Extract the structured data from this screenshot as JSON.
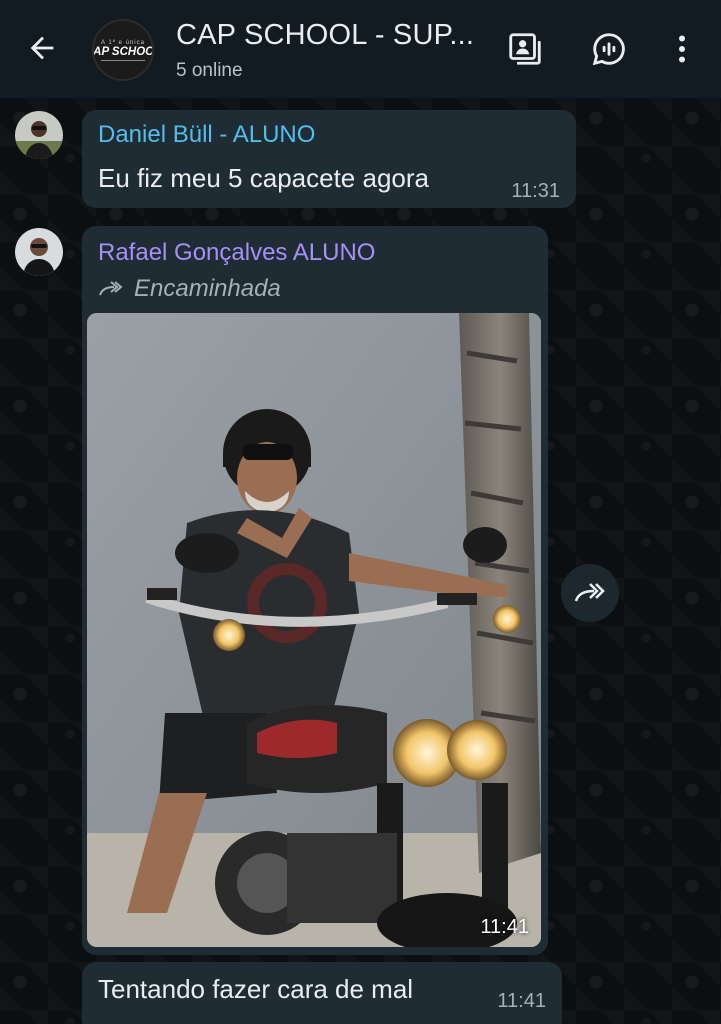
{
  "header": {
    "title": "CAP SCHOOL - SUP...",
    "status": "5 online",
    "logo_top": "A 1ª e única",
    "logo_main": "CAP SCHOOL"
  },
  "messages": [
    {
      "sender": "Daniel Büll - ALUNO",
      "sender_color": "#53bdeb",
      "text": "Eu fiz meu 5 capacete agora",
      "time": "11:31"
    },
    {
      "sender": "Rafael Gonçalves ALUNO",
      "sender_color": "#a68ff5",
      "forwarded_label": "Encaminhada",
      "photo_time": "11:41",
      "caption": "Tentando fazer cara de mal",
      "caption_time": "11:41"
    }
  ],
  "icons": {
    "back": "back-arrow-icon",
    "profile": "contact-card-icon",
    "voice_chat": "voice-chat-icon",
    "menu": "more-vert-icon",
    "forward": "forward-icon",
    "share": "share-forward-icon"
  },
  "colors": {
    "header_bg": "#121b22",
    "bubble_bg": "#1f2c34",
    "text": "#e9edef"
  }
}
